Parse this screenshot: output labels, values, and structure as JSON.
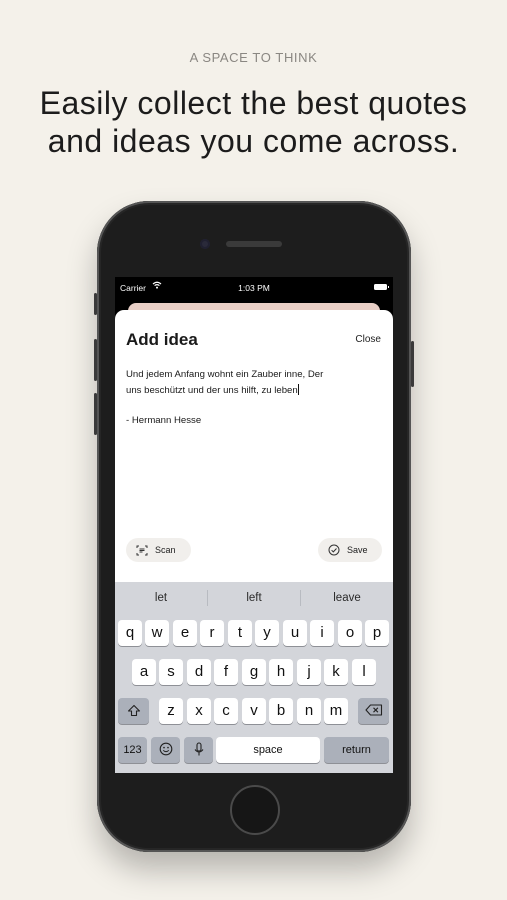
{
  "header": {
    "eyebrow": "A SPACE TO THINK",
    "headline_line1": "Easily collect the best quotes",
    "headline_line2": "and ideas you come across."
  },
  "status_bar": {
    "carrier": "Carrier",
    "time": "1:03 PM"
  },
  "sheet": {
    "title": "Add idea",
    "close_label": "Close",
    "note_lines": [
      "Und jedem Anfang wohnt ein Zauber inne, Der",
      "uns beschützt und der uns hilft, zu leben",
      "",
      "- Hermann Hesse"
    ],
    "scan_label": "Scan",
    "save_label": "Save"
  },
  "keyboard": {
    "suggestions": [
      "let",
      "left",
      "leave"
    ],
    "row1": [
      "q",
      "w",
      "e",
      "r",
      "t",
      "y",
      "u",
      "i",
      "o",
      "p"
    ],
    "row2": [
      "a",
      "s",
      "d",
      "f",
      "g",
      "h",
      "j",
      "k",
      "l"
    ],
    "row3": [
      "z",
      "x",
      "c",
      "v",
      "b",
      "n",
      "m"
    ],
    "numbers_label": "123",
    "space_label": "space",
    "return_label": "return"
  },
  "icons": [
    "wifi-icon",
    "battery-icon",
    "scan-icon",
    "checkmark-circle-icon",
    "shift-icon",
    "backspace-icon",
    "emoji-icon",
    "microphone-icon"
  ]
}
